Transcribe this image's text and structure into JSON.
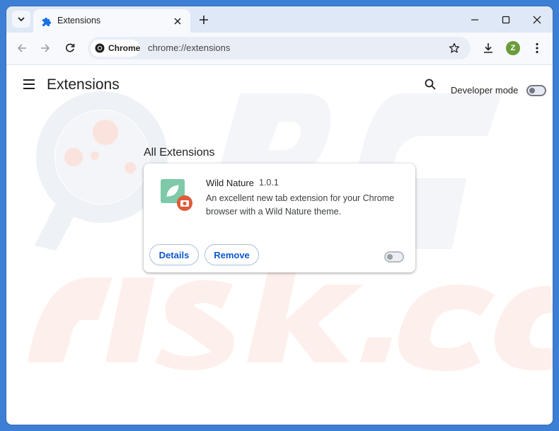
{
  "tab": {
    "title": "Extensions",
    "icon": "puzzle-piece-icon"
  },
  "toolbar": {
    "chip_label": "Chrome",
    "url": "chrome://extensions",
    "avatar_letter": "Z"
  },
  "page": {
    "title": "Extensions",
    "developer_mode_label": "Developer mode",
    "developer_mode_enabled": false,
    "section_title": "All Extensions"
  },
  "extension": {
    "name": "Wild Nature",
    "version": "1.0.1",
    "description": "An excellent new tab extension for your Chrome browser with a Wild Nature theme.",
    "details_label": "Details",
    "remove_label": "Remove",
    "enabled": false
  },
  "colors": {
    "accent": "#0b57d0",
    "frame": "#3d7fd4",
    "tabstrip": "#dfe8f6",
    "ext_icon_bg": "#7ec9a8",
    "ext_badge": "#e05a3a"
  }
}
